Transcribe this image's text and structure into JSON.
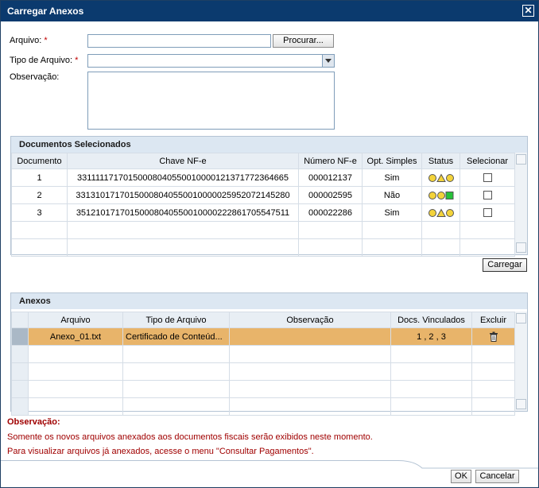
{
  "window": {
    "title": "Carregar Anexos"
  },
  "form": {
    "arquivo_label": "Arquivo:",
    "tipo_label": "Tipo de Arquivo:",
    "obs_label": "Observação:",
    "required_marker": "*",
    "browse_button": "Procurar..."
  },
  "docs_panel": {
    "title": "Documentos Selecionados",
    "columns": [
      "Documento",
      "Chave NF-e",
      "Número NF-e",
      "Opt. Simples",
      "Status",
      "Selecionar"
    ],
    "rows": [
      {
        "documento": "1",
        "chave": "33111117170150008040550010000121371772364665",
        "numero": "000012137",
        "opt": "Sim",
        "status": [
          "yellow-circle",
          "yellow-triangle",
          "yellow-circle"
        ]
      },
      {
        "documento": "2",
        "chave": "33131017170150008040550010000025952072145280",
        "numero": "000002595",
        "opt": "Não",
        "status": [
          "yellow-circle",
          "yellow-circle",
          "green-square"
        ]
      },
      {
        "documento": "3",
        "chave": "35121017170150008040550010000222861705547511",
        "numero": "000022286",
        "opt": "Sim",
        "status": [
          "yellow-circle",
          "yellow-triangle",
          "yellow-circle"
        ]
      }
    ],
    "load_button": "Carregar"
  },
  "anexos_panel": {
    "title": "Anexos",
    "columns": [
      "Arquivo",
      "Tipo de Arquivo",
      "Observação",
      "Docs. Vinculados",
      "Excluir"
    ],
    "rows": [
      {
        "arquivo": "Anexo_01.txt",
        "tipo": "Certificado de Conteúd...",
        "obs": "",
        "docs": "1 , 2 , 3",
        "excluir_icon": "trash-icon"
      }
    ]
  },
  "note": {
    "title": "Observação:",
    "line1": "Somente os novos arquivos anexados aos documentos fiscais serão exibidos neste momento.",
    "line2": "Para visualizar arquivos já anexados, acesse o menu \"Consultar Pagamentos\"."
  },
  "footer": {
    "ok": "OK",
    "cancel": "Cancelar"
  },
  "colors": {
    "title_bar": "#0b3a6e",
    "selected_row": "#e8b46a",
    "required": "#c00000",
    "note_text": "#a00000"
  }
}
